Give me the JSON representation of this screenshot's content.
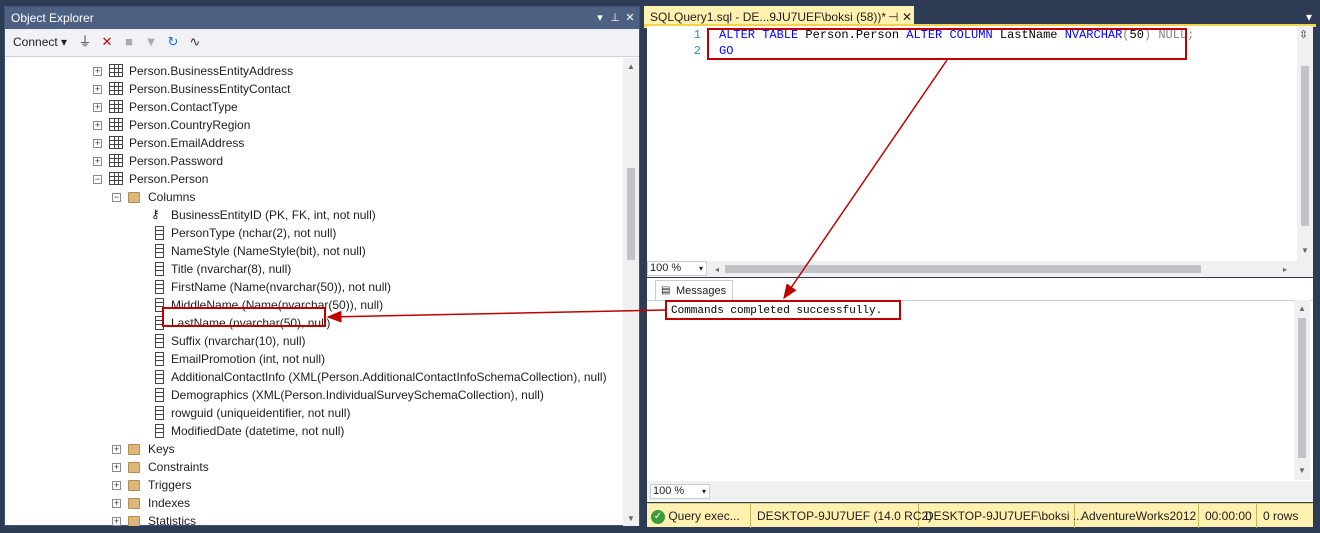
{
  "object_explorer": {
    "title": "Object Explorer",
    "title_icons": [
      "dropdown-icon",
      "pin-icon",
      "close-icon"
    ],
    "toolbar": {
      "connect_label": "Connect",
      "icons": [
        "connect-plug-icon",
        "disconnect-icon",
        "stop-icon",
        "filter-icon",
        "refresh-icon",
        "activity-monitor-icon"
      ]
    },
    "tree": [
      {
        "label": "Person.BusinessEntityAddress",
        "type": "table",
        "expander": "+"
      },
      {
        "label": "Person.BusinessEntityContact",
        "type": "table",
        "expander": "+"
      },
      {
        "label": "Person.ContactType",
        "type": "table",
        "expander": "+"
      },
      {
        "label": "Person.CountryRegion",
        "type": "table",
        "expander": "+"
      },
      {
        "label": "Person.EmailAddress",
        "type": "table",
        "expander": "+"
      },
      {
        "label": "Person.Password",
        "type": "table",
        "expander": "+"
      },
      {
        "label": "Person.Person",
        "type": "table",
        "expander": "−"
      },
      {
        "label": "Columns",
        "type": "folder",
        "expander": "−"
      },
      {
        "label": "BusinessEntityID (PK, FK, int, not null)",
        "type": "key"
      },
      {
        "label": "PersonType (nchar(2), not null)",
        "type": "column"
      },
      {
        "label": "NameStyle (NameStyle(bit), not null)",
        "type": "column"
      },
      {
        "label": "Title (nvarchar(8), null)",
        "type": "column"
      },
      {
        "label": "FirstName (Name(nvarchar(50)), not null)",
        "type": "column"
      },
      {
        "label": "MiddleName (Name(nvarchar(50)), null)",
        "type": "column"
      },
      {
        "label": "LastName (nvarchar(50), null)",
        "type": "column"
      },
      {
        "label": "Suffix (nvarchar(10), null)",
        "type": "column"
      },
      {
        "label": "EmailPromotion (int, not null)",
        "type": "column"
      },
      {
        "label": "AdditionalContactInfo (XML(Person.AdditionalContactInfoSchemaCollection), null)",
        "type": "column"
      },
      {
        "label": "Demographics (XML(Person.IndividualSurveySchemaCollection), null)",
        "type": "column"
      },
      {
        "label": "rowguid (uniqueidentifier, not null)",
        "type": "column"
      },
      {
        "label": "ModifiedDate (datetime, not null)",
        "type": "column"
      },
      {
        "label": "Keys",
        "type": "folder",
        "expander": "+"
      },
      {
        "label": "Constraints",
        "type": "folder",
        "expander": "+"
      },
      {
        "label": "Triggers",
        "type": "folder",
        "expander": "+"
      },
      {
        "label": "Indexes",
        "type": "folder",
        "expander": "+"
      },
      {
        "label": "Statistics",
        "type": "folder",
        "expander": "+"
      }
    ]
  },
  "editor": {
    "tab_title": "SQLQuery1.sql - DE...9JU7UEF\\boksi (58))*",
    "tab_pin": "⊣",
    "tab_close": "✕",
    "line_numbers": [
      "1",
      "2"
    ],
    "code_line1": {
      "kw1": "ALTER TABLE",
      "t1": " Person.Person ",
      "kw2": "ALTER COLUMN",
      "t2": " LastName ",
      "kw3": "NVARCHAR",
      "p1": "(",
      "num": "50",
      "p2": ")",
      "t3": " ",
      "kw4": "NULL",
      "semi": ";"
    },
    "code_line2": {
      "kw": "GO"
    },
    "zoom": "100 %"
  },
  "results": {
    "tab_label": "Messages",
    "message": "Commands completed successfully.",
    "zoom": "100 %"
  },
  "status_bar": {
    "query_status": "Query exec...",
    "server": "DESKTOP-9JU7UEF (14.0 RC2)",
    "login": "DESKTOP-9JU7UEF\\boksi ...",
    "database": "AdventureWorks2012",
    "elapsed": "00:00:00",
    "rows": "0 rows"
  },
  "colors": {
    "title_bar": "#4d6082",
    "tab_active": "#fff1b0",
    "annotation": "#c00000",
    "keyword": "#0000ff"
  }
}
